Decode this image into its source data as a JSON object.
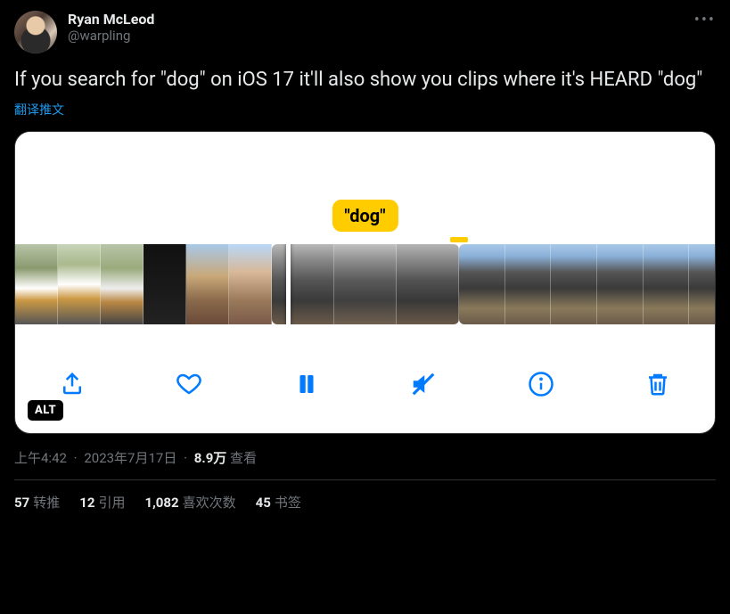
{
  "user": {
    "display_name": "Ryan McLeod",
    "handle": "@warpling"
  },
  "tweet_text": "If you search for \"dog\" on iOS 17 it'll also show you clips where it's HEARD \"dog\"",
  "translate_label": "翻译推文",
  "media": {
    "tooltip": "\"dog\"",
    "alt_badge": "ALT",
    "toolbar": {
      "share": "share",
      "like": "like",
      "pause": "pause",
      "mute": "mute",
      "info": "info",
      "trash": "trash"
    }
  },
  "meta": {
    "time": "上午4:42",
    "date": "2023年7月17日",
    "separator": "·",
    "views_count": "8.9万",
    "views_label": "查看"
  },
  "stats": {
    "retweets": {
      "count": "57",
      "label": "转推"
    },
    "quotes": {
      "count": "12",
      "label": "引用"
    },
    "likes": {
      "count": "1,082",
      "label": "喜欢次数"
    },
    "bookmarks": {
      "count": "45",
      "label": "书签"
    }
  }
}
